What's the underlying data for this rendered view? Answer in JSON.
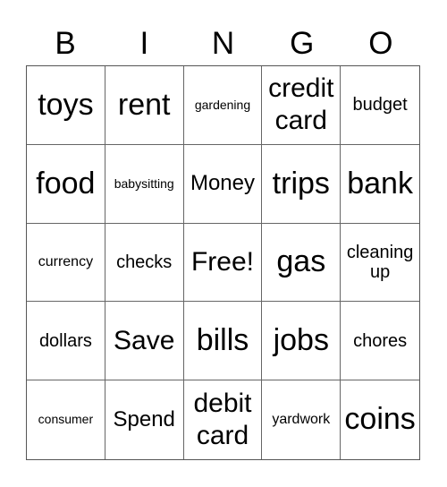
{
  "header": {
    "letters": [
      "B",
      "I",
      "N",
      "G",
      "O"
    ]
  },
  "grid": {
    "cells": [
      "toys",
      "rent",
      "gardening",
      "credit card",
      "budget",
      "food",
      "babysitting",
      "Money",
      "trips",
      "bank",
      "currency",
      "checks",
      "Free!",
      "gas",
      "cleaning up",
      "dollars",
      "Save",
      "bills",
      "jobs",
      "chores",
      "consumer",
      "Spend",
      "debit card",
      "yardwork",
      "coins"
    ]
  }
}
